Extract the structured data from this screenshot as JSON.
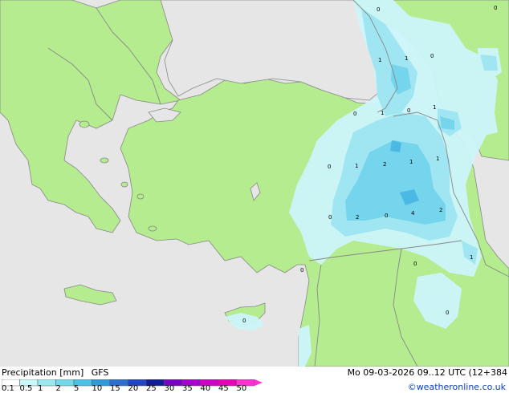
{
  "header": {
    "title": "Precipitation [mm]",
    "model": "GFS",
    "valid_time": "Mo 09-03-2026 09..12 UTC (12+384",
    "credit": "©weatheronline.co.uk"
  },
  "legend": {
    "ticks": [
      "0.1",
      "0.5",
      "1",
      "2",
      "5",
      "10",
      "15",
      "20",
      "25",
      "30",
      "35",
      "40",
      "45",
      "50"
    ],
    "colors": [
      "#ffffff",
      "#c8f8fa",
      "#9ce8f2",
      "#72d8ec",
      "#4ac2e6",
      "#2e9ad8",
      "#2a6ed0",
      "#2046c8",
      "#101c98",
      "#7a00c8",
      "#a800d0",
      "#d000c8",
      "#e800b8",
      "#ff30d0"
    ]
  },
  "colors": {
    "land": "#b5ec8f",
    "sea": "#e6e6e6",
    "border": "#888888",
    "rain_light": "#ccf6fa",
    "rain_mid": "#9fe6f2",
    "rain_heavy": "#75d5ec",
    "rain_core": "#4cb8e4"
  },
  "precip_labels": [
    "0",
    "1",
    "1",
    "0",
    "0",
    "1",
    "1",
    "0",
    "1",
    "2",
    "1",
    "1",
    "0",
    "2",
    "0",
    "4",
    "2",
    "1",
    "0",
    "0",
    "0",
    "0",
    "0",
    "0"
  ]
}
